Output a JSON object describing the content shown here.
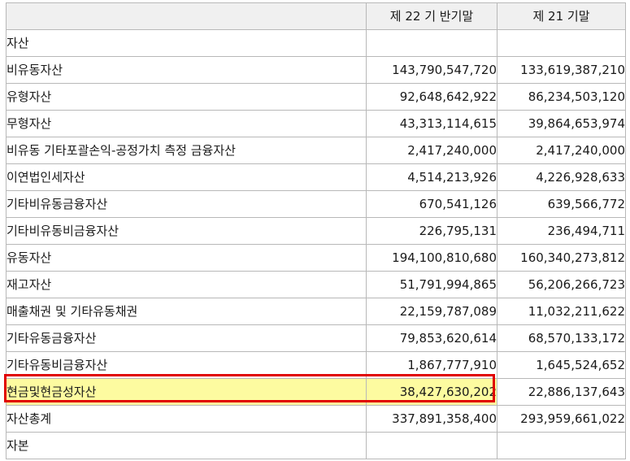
{
  "table": {
    "headers": [
      "",
      "제 22 기 반기말",
      "제 21 기말"
    ],
    "rows": [
      {
        "label": "자산",
        "current": "",
        "previous": ""
      },
      {
        "label": "비유동자산",
        "current": "143,790,547,720",
        "previous": "133,619,387,210"
      },
      {
        "label": "유형자산",
        "current": "92,648,642,922",
        "previous": "86,234,503,120"
      },
      {
        "label": "무형자산",
        "current": "43,313,114,615",
        "previous": "39,864,653,974"
      },
      {
        "label": "비유동 기타포괄손익-공정가치 측정 금융자산",
        "current": "2,417,240,000",
        "previous": "2,417,240,000"
      },
      {
        "label": "이연법인세자산",
        "current": "4,514,213,926",
        "previous": "4,226,928,633"
      },
      {
        "label": "기타비유동금융자산",
        "current": "670,541,126",
        "previous": "639,566,772"
      },
      {
        "label": "기타비유동비금융자산",
        "current": "226,795,131",
        "previous": "236,494,711"
      },
      {
        "label": "유동자산",
        "current": "194,100,810,680",
        "previous": "160,340,273,812"
      },
      {
        "label": "재고자산",
        "current": "51,791,994,865",
        "previous": "56,206,266,723"
      },
      {
        "label": "매출채권 및 기타유동채권",
        "current": "22,159,787,089",
        "previous": "11,032,211,622"
      },
      {
        "label": "기타유동금융자산",
        "current": "79,853,620,614",
        "previous": "68,570,133,172"
      },
      {
        "label": "기타유동비금융자산",
        "current": "1,867,777,910",
        "previous": "1,645,524,652"
      },
      {
        "label": "현금및현금성자산",
        "current": "38,427,630,202",
        "previous": "22,886,137,643"
      },
      {
        "label": "자산총계",
        "current": "337,891,358,400",
        "previous": "293,959,661,022"
      },
      {
        "label": "자본",
        "current": "",
        "previous": ""
      }
    ]
  },
  "colors": {
    "highlight_fill": "#fdfba0",
    "highlight_border": "#e00000",
    "grid": "#b8b8b8",
    "header_bg": "#f0f0f0"
  }
}
